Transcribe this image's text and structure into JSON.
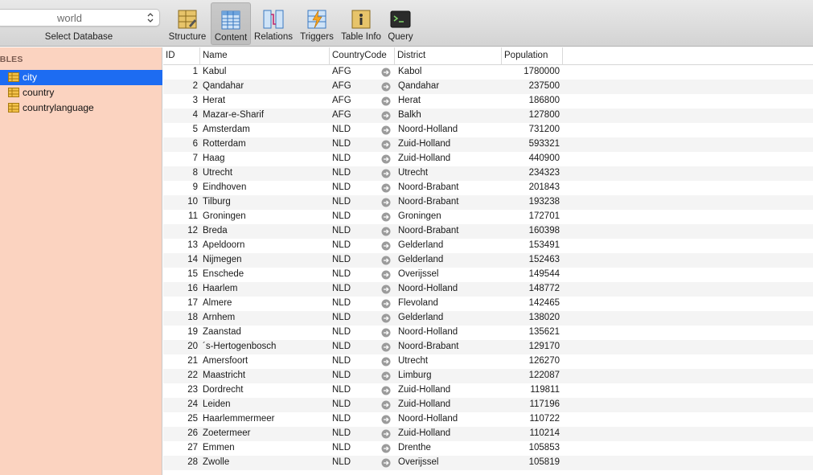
{
  "toolbar": {
    "database": "world",
    "database_label": "Select Database",
    "buttons": [
      {
        "label": "Structure"
      },
      {
        "label": "Content"
      },
      {
        "label": "Relations"
      },
      {
        "label": "Triggers"
      },
      {
        "label": "Table Info"
      },
      {
        "label": "Query"
      }
    ],
    "active": "Content"
  },
  "sidebar": {
    "header": "ABLES",
    "items": [
      {
        "label": "city",
        "selected": true
      },
      {
        "label": "country"
      },
      {
        "label": "countrylanguage"
      }
    ]
  },
  "grid": {
    "columns": [
      "ID",
      "Name",
      "CountryCode",
      "District",
      "Population"
    ],
    "rows": [
      [
        "1",
        "Kabul",
        "AFG",
        "Kabol",
        "1780000"
      ],
      [
        "2",
        "Qandahar",
        "AFG",
        "Qandahar",
        "237500"
      ],
      [
        "3",
        "Herat",
        "AFG",
        "Herat",
        "186800"
      ],
      [
        "4",
        "Mazar-e-Sharif",
        "AFG",
        "Balkh",
        "127800"
      ],
      [
        "5",
        "Amsterdam",
        "NLD",
        "Noord-Holland",
        "731200"
      ],
      [
        "6",
        "Rotterdam",
        "NLD",
        "Zuid-Holland",
        "593321"
      ],
      [
        "7",
        "Haag",
        "NLD",
        "Zuid-Holland",
        "440900"
      ],
      [
        "8",
        "Utrecht",
        "NLD",
        "Utrecht",
        "234323"
      ],
      [
        "9",
        "Eindhoven",
        "NLD",
        "Noord-Brabant",
        "201843"
      ],
      [
        "10",
        "Tilburg",
        "NLD",
        "Noord-Brabant",
        "193238"
      ],
      [
        "11",
        "Groningen",
        "NLD",
        "Groningen",
        "172701"
      ],
      [
        "12",
        "Breda",
        "NLD",
        "Noord-Brabant",
        "160398"
      ],
      [
        "13",
        "Apeldoorn",
        "NLD",
        "Gelderland",
        "153491"
      ],
      [
        "14",
        "Nijmegen",
        "NLD",
        "Gelderland",
        "152463"
      ],
      [
        "15",
        "Enschede",
        "NLD",
        "Overijssel",
        "149544"
      ],
      [
        "16",
        "Haarlem",
        "NLD",
        "Noord-Holland",
        "148772"
      ],
      [
        "17",
        "Almere",
        "NLD",
        "Flevoland",
        "142465"
      ],
      [
        "18",
        "Arnhem",
        "NLD",
        "Gelderland",
        "138020"
      ],
      [
        "19",
        "Zaanstad",
        "NLD",
        "Noord-Holland",
        "135621"
      ],
      [
        "20",
        "´s-Hertogenbosch",
        "NLD",
        "Noord-Brabant",
        "129170"
      ],
      [
        "21",
        "Amersfoort",
        "NLD",
        "Utrecht",
        "126270"
      ],
      [
        "22",
        "Maastricht",
        "NLD",
        "Limburg",
        "122087"
      ],
      [
        "23",
        "Dordrecht",
        "NLD",
        "Zuid-Holland",
        "119811"
      ],
      [
        "24",
        "Leiden",
        "NLD",
        "Zuid-Holland",
        "117196"
      ],
      [
        "25",
        "Haarlemmermeer",
        "NLD",
        "Noord-Holland",
        "110722"
      ],
      [
        "26",
        "Zoetermeer",
        "NLD",
        "Zuid-Holland",
        "110214"
      ],
      [
        "27",
        "Emmen",
        "NLD",
        "Drenthe",
        "105853"
      ],
      [
        "28",
        "Zwolle",
        "NLD",
        "Overijssel",
        "105819"
      ]
    ]
  },
  "colors": {
    "sidebar_bg": "#fbd3c0",
    "selection": "#1d6cf2",
    "row_alt": "#f4f4f4"
  }
}
